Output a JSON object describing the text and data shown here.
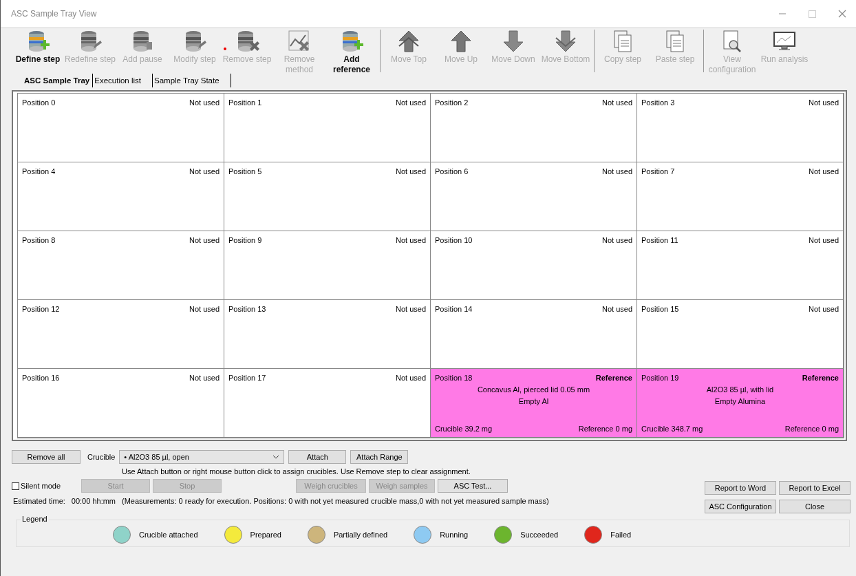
{
  "window": {
    "title": "ASC Sample Tray View"
  },
  "toolbar_groups": [
    {
      "items": [
        {
          "label": "Define step",
          "kind": "disk-add",
          "enabled": true
        },
        {
          "label": "Redefine step",
          "kind": "disk-edit",
          "enabled": false
        },
        {
          "label": "Add pause",
          "kind": "disk-pause",
          "enabled": false
        },
        {
          "label": "Modify step",
          "kind": "disk-edit",
          "enabled": false
        },
        {
          "label": "Remove step",
          "kind": "disk-remove",
          "enabled": false
        },
        {
          "label": "Remove method",
          "kind": "chart-remove",
          "enabled": false
        },
        {
          "label": "Add reference",
          "kind": "disk-add",
          "enabled": true
        }
      ]
    },
    {
      "items": [
        {
          "label": "Move Top",
          "kind": "double-up",
          "enabled": false
        },
        {
          "label": "Move Up",
          "kind": "up",
          "enabled": false
        },
        {
          "label": "Move Down",
          "kind": "down",
          "enabled": false
        },
        {
          "label": "Move Bottom",
          "kind": "double-down",
          "enabled": false
        }
      ]
    },
    {
      "items": [
        {
          "label": "Copy step",
          "kind": "copy",
          "enabled": false
        },
        {
          "label": "Paste step",
          "kind": "paste",
          "enabled": false
        }
      ]
    },
    {
      "items": [
        {
          "label": "View configuration",
          "kind": "view",
          "enabled": false
        },
        {
          "label": "Run analysis",
          "kind": "monitor",
          "enabled": false
        }
      ]
    }
  ],
  "tabs": [
    {
      "label": "ASC Sample Tray",
      "selected": true
    },
    {
      "label": "Execution list",
      "selected": false
    },
    {
      "label": "Sample Tray State",
      "selected": false
    }
  ],
  "positions": [
    {
      "kind": "empty",
      "name": "Position 0",
      "status": "Not used"
    },
    {
      "kind": "empty",
      "name": "Position 1",
      "status": "Not used"
    },
    {
      "kind": "empty",
      "name": "Position 2",
      "status": "Not used"
    },
    {
      "kind": "empty",
      "name": "Position 3",
      "status": "Not used"
    },
    {
      "kind": "empty",
      "name": "Position 4",
      "status": "Not used"
    },
    {
      "kind": "empty",
      "name": "Position 5",
      "status": "Not used"
    },
    {
      "kind": "empty",
      "name": "Position 6",
      "status": "Not used"
    },
    {
      "kind": "empty",
      "name": "Position 7",
      "status": "Not used"
    },
    {
      "kind": "empty",
      "name": "Position 8",
      "status": "Not used"
    },
    {
      "kind": "empty",
      "name": "Position 9",
      "status": "Not used"
    },
    {
      "kind": "empty",
      "name": "Position 10",
      "status": "Not used"
    },
    {
      "kind": "empty",
      "name": "Position 11",
      "status": "Not used"
    },
    {
      "kind": "empty",
      "name": "Position 12",
      "status": "Not used"
    },
    {
      "kind": "empty",
      "name": "Position 13",
      "status": "Not used"
    },
    {
      "kind": "empty",
      "name": "Position 14",
      "status": "Not used"
    },
    {
      "kind": "empty",
      "name": "Position 15",
      "status": "Not used"
    },
    {
      "kind": "empty",
      "name": "Position 16",
      "status": "Not used"
    },
    {
      "kind": "empty",
      "name": "Position 17",
      "status": "Not used"
    },
    {
      "kind": "reference",
      "name": "Position 18",
      "status": "Reference",
      "crucible_type": "Concavus Al, pierced lid 0.05 mm",
      "sample": "Empty Al",
      "crucible_mass": "Crucible 39.2 mg",
      "sample_mass": "Reference 0 mg"
    },
    {
      "kind": "reference",
      "name": "Position 19",
      "status": "Reference",
      "crucible_type": "Al2O3 85 µl, with lid",
      "sample": "Empty Alumina",
      "crucible_mass": "Crucible 348.7 mg",
      "sample_mass": "Reference 0 mg"
    }
  ],
  "attach_bar": {
    "remove_all": "Remove all",
    "crucible_label": "Crucible",
    "crucible_value": "• Al2O3 85 µl, open",
    "attach": "Attach",
    "attach_range": "Attach Range",
    "hint": "Use Attach button or right mouse button click to assign crucibles. Use Remove step to clear assignment."
  },
  "silent_mode": {
    "label": "Silent mode",
    "checked": false
  },
  "action_buttons": [
    {
      "label": "Start",
      "disabled": true
    },
    {
      "label": "Stop",
      "disabled": true
    },
    {
      "label": "Weigh crucibles",
      "disabled": true
    },
    {
      "label": "Weigh samples",
      "disabled": true
    },
    {
      "label": "ASC Test...",
      "disabled": false
    }
  ],
  "estimate": {
    "label": "Estimated time:",
    "value": "00:00 hh:mm",
    "details": "(Measurements: 0 ready for execution. Positions: 0 with not yet measured crucible mass,0 with not yet measured sample mass)"
  },
  "side_buttons": [
    {
      "label": "Report to Word"
    },
    {
      "label": "Report to Excel"
    },
    {
      "label": "ASC Configuration"
    },
    {
      "label": "Close"
    }
  ],
  "legend": {
    "title": "Legend",
    "items": [
      {
        "label": "Crucible attached",
        "color": "#8fd3c9"
      },
      {
        "label": "Prepared",
        "color": "#f4ea3c"
      },
      {
        "label": "Partially defined",
        "color": "#cdb57c"
      },
      {
        "label": "Running",
        "color": "#8ecaf2"
      },
      {
        "label": "Succeeded",
        "color": "#6cb52e"
      },
      {
        "label": "Failed",
        "color": "#e0261c"
      }
    ]
  }
}
